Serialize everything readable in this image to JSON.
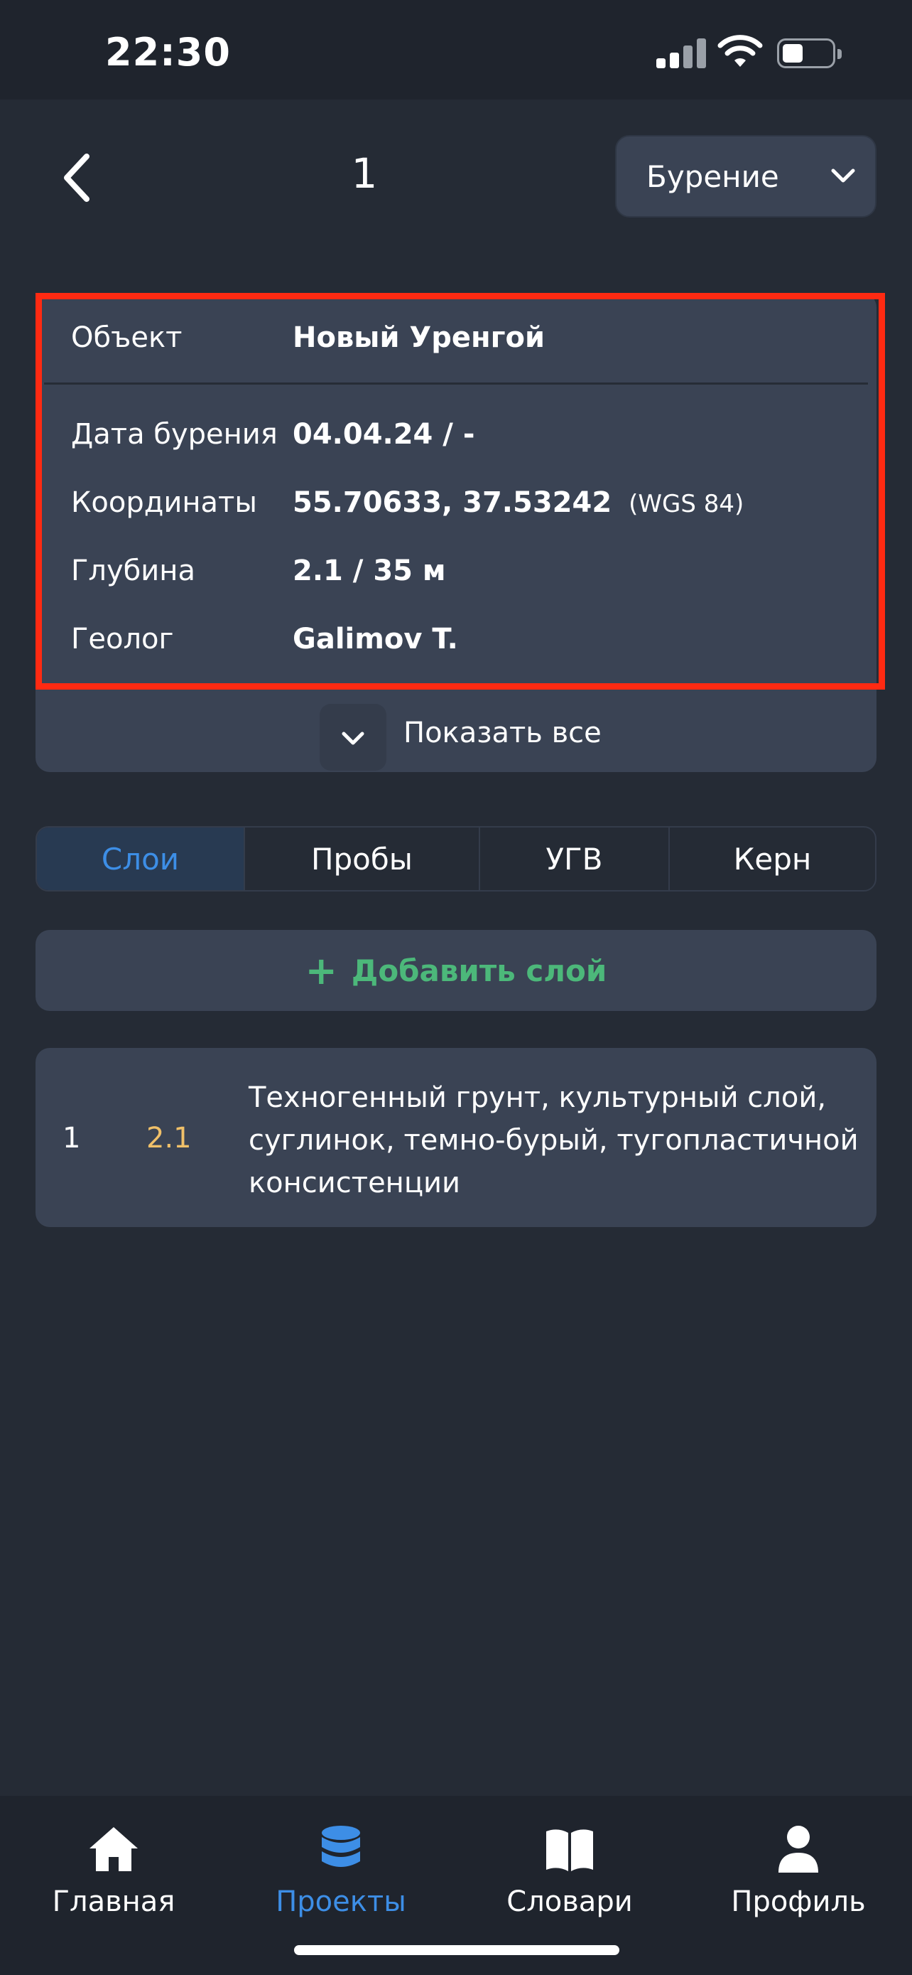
{
  "status_bar": {
    "time": "22:30"
  },
  "header": {
    "title": "1",
    "mode_select": "Бурение"
  },
  "info": {
    "object_label": "Объект",
    "object_value": "Новый Уренгой",
    "drill_date_label": "Дата бурения",
    "drill_date_value": "04.04.24 / -",
    "coords_label": "Координаты",
    "coords_value": "55.70633, 37.53242",
    "coords_system": "(WGS 84)",
    "depth_label": "Глубина",
    "depth_value": "2.1 / 35 м",
    "geologist_label": "Геолог",
    "geologist_value": "Galimov T.",
    "show_all": "Показать все"
  },
  "tabs": [
    "Слои",
    "Пробы",
    "УГВ",
    "Керн"
  ],
  "add_layer": {
    "plus": "+",
    "label": "Добавить слой"
  },
  "layers": [
    {
      "num": "1",
      "depth": "2.1",
      "description": "Техногенный грунт, культурный слой, суглинок, темно-бурый, тугопластичной консистенции"
    }
  ],
  "nav": {
    "home": "Главная",
    "projects": "Проекты",
    "dictionaries": "Словари",
    "profile": "Профиль"
  },
  "colors": {
    "background": "#252b35",
    "card": "#3a4354",
    "accent_blue": "#3d8ee6",
    "accent_green": "#4cb87a",
    "depth_yellow": "#f0c069",
    "highlight_red": "#ff2a12"
  }
}
